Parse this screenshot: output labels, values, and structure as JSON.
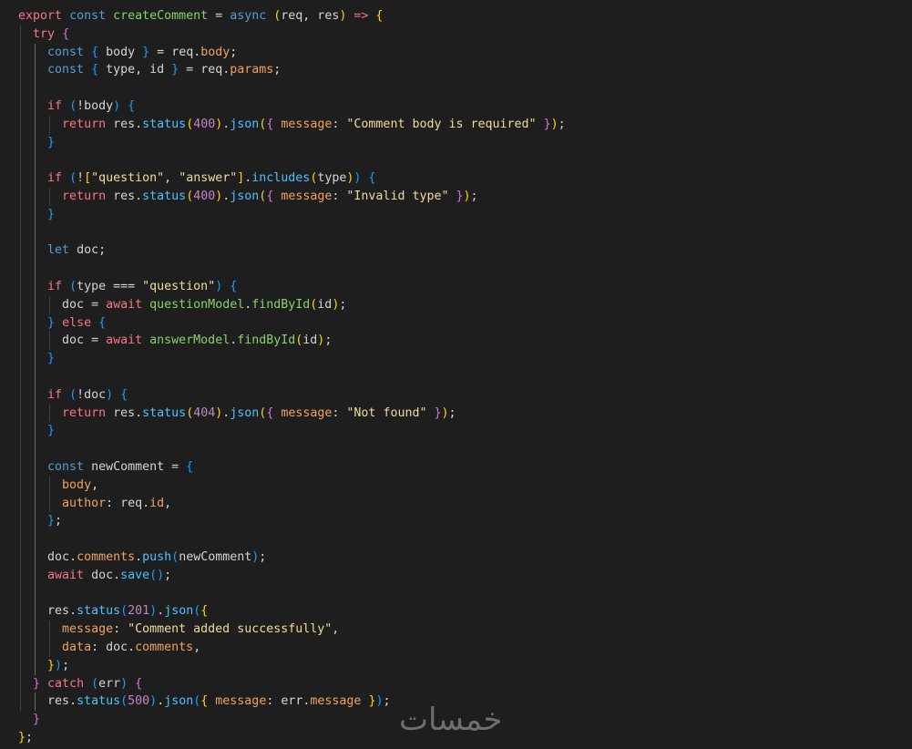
{
  "colors": {
    "kw": "#f97583",
    "decl": "#569cd6",
    "ctrl": "#f97583",
    "fn": "#4fc1ff",
    "fnname": "#86d36b",
    "str": "#f0dc9a",
    "num": "#c586c0",
    "prop": "#f0a35e",
    "plain": "#d4d4d4",
    "punct": "#d4d4d4",
    "b1": "#ffd700",
    "b2": "#da70d6",
    "b3": "#179fff",
    "op": "#d4d4d4"
  },
  "watermark": "خمسات",
  "lines": [
    [
      [
        "export",
        "kw"
      ],
      [
        " ",
        "plain"
      ],
      [
        "const",
        "decl"
      ],
      [
        " ",
        "plain"
      ],
      [
        "createComment",
        "fnname"
      ],
      [
        " = ",
        "op"
      ],
      [
        "async",
        "decl"
      ],
      [
        " ",
        "plain"
      ],
      [
        "(",
        "b1"
      ],
      [
        "req, res",
        "plain"
      ],
      [
        ")",
        "b1"
      ],
      [
        " => ",
        "kw"
      ],
      [
        "{",
        "b1"
      ]
    ],
    [
      [
        "  ",
        "plain"
      ],
      [
        "try",
        "kw"
      ],
      [
        " ",
        "plain"
      ],
      [
        "{",
        "b2"
      ]
    ],
    [
      [
        "    ",
        "plain"
      ],
      [
        "const",
        "decl"
      ],
      [
        " ",
        "plain"
      ],
      [
        "{",
        "b3"
      ],
      [
        " body ",
        "plain"
      ],
      [
        "}",
        "b3"
      ],
      [
        " = ",
        "op"
      ],
      [
        "req",
        "plain"
      ],
      [
        ".",
        "punct"
      ],
      [
        "body",
        "prop"
      ],
      [
        ";",
        "punct"
      ]
    ],
    [
      [
        "    ",
        "plain"
      ],
      [
        "const",
        "decl"
      ],
      [
        " ",
        "plain"
      ],
      [
        "{",
        "b3"
      ],
      [
        " type, id ",
        "plain"
      ],
      [
        "}",
        "b3"
      ],
      [
        " = ",
        "op"
      ],
      [
        "req",
        "plain"
      ],
      [
        ".",
        "punct"
      ],
      [
        "params",
        "prop"
      ],
      [
        ";",
        "punct"
      ]
    ],
    [],
    [
      [
        "    ",
        "plain"
      ],
      [
        "if",
        "kw"
      ],
      [
        " ",
        "plain"
      ],
      [
        "(",
        "b3"
      ],
      [
        "!body",
        "plain"
      ],
      [
        ")",
        "b3"
      ],
      [
        " ",
        "plain"
      ],
      [
        "{",
        "b3"
      ]
    ],
    [
      [
        "      ",
        "plain"
      ],
      [
        "return",
        "kw"
      ],
      [
        " res",
        "plain"
      ],
      [
        ".",
        "punct"
      ],
      [
        "status",
        "fn"
      ],
      [
        "(",
        "b1"
      ],
      [
        "400",
        "num"
      ],
      [
        ")",
        "b1"
      ],
      [
        ".",
        "punct"
      ],
      [
        "json",
        "fn"
      ],
      [
        "(",
        "b1"
      ],
      [
        "{",
        "b2"
      ],
      [
        " ",
        "plain"
      ],
      [
        "message",
        "prop"
      ],
      [
        ": ",
        "punct"
      ],
      [
        "\"Comment body is required\"",
        "str"
      ],
      [
        " ",
        "plain"
      ],
      [
        "}",
        "b2"
      ],
      [
        ")",
        "b1"
      ],
      [
        ";",
        "punct"
      ]
    ],
    [
      [
        "    ",
        "plain"
      ],
      [
        "}",
        "b3"
      ]
    ],
    [],
    [
      [
        "    ",
        "plain"
      ],
      [
        "if",
        "kw"
      ],
      [
        " ",
        "plain"
      ],
      [
        "(",
        "b3"
      ],
      [
        "!",
        "plain"
      ],
      [
        "[",
        "b1"
      ],
      [
        "\"question\"",
        "str"
      ],
      [
        ", ",
        "plain"
      ],
      [
        "\"answer\"",
        "str"
      ],
      [
        "]",
        "b1"
      ],
      [
        ".",
        "punct"
      ],
      [
        "includes",
        "fn"
      ],
      [
        "(",
        "b1"
      ],
      [
        "type",
        "plain"
      ],
      [
        ")",
        "b1"
      ],
      [
        ")",
        "b3"
      ],
      [
        " ",
        "plain"
      ],
      [
        "{",
        "b3"
      ]
    ],
    [
      [
        "      ",
        "plain"
      ],
      [
        "return",
        "kw"
      ],
      [
        " res",
        "plain"
      ],
      [
        ".",
        "punct"
      ],
      [
        "status",
        "fn"
      ],
      [
        "(",
        "b1"
      ],
      [
        "400",
        "num"
      ],
      [
        ")",
        "b1"
      ],
      [
        ".",
        "punct"
      ],
      [
        "json",
        "fn"
      ],
      [
        "(",
        "b1"
      ],
      [
        "{",
        "b2"
      ],
      [
        " ",
        "plain"
      ],
      [
        "message",
        "prop"
      ],
      [
        ": ",
        "punct"
      ],
      [
        "\"Invalid type\"",
        "str"
      ],
      [
        " ",
        "plain"
      ],
      [
        "}",
        "b2"
      ],
      [
        ")",
        "b1"
      ],
      [
        ";",
        "punct"
      ]
    ],
    [
      [
        "    ",
        "plain"
      ],
      [
        "}",
        "b3"
      ]
    ],
    [],
    [
      [
        "    ",
        "plain"
      ],
      [
        "let",
        "decl"
      ],
      [
        " doc;",
        "plain"
      ]
    ],
    [],
    [
      [
        "    ",
        "plain"
      ],
      [
        "if",
        "kw"
      ],
      [
        " ",
        "plain"
      ],
      [
        "(",
        "b3"
      ],
      [
        "type === ",
        "plain"
      ],
      [
        "\"question\"",
        "str"
      ],
      [
        ")",
        "b3"
      ],
      [
        " ",
        "plain"
      ],
      [
        "{",
        "b3"
      ]
    ],
    [
      [
        "      ",
        "plain"
      ],
      [
        "doc = ",
        "plain"
      ],
      [
        "await",
        "kw"
      ],
      [
        " ",
        "plain"
      ],
      [
        "questionModel",
        "fnname"
      ],
      [
        ".",
        "punct"
      ],
      [
        "findById",
        "fnname"
      ],
      [
        "(",
        "b1"
      ],
      [
        "id",
        "plain"
      ],
      [
        ")",
        "b1"
      ],
      [
        ";",
        "punct"
      ]
    ],
    [
      [
        "    ",
        "plain"
      ],
      [
        "}",
        "b3"
      ],
      [
        " ",
        "plain"
      ],
      [
        "else",
        "kw"
      ],
      [
        " ",
        "plain"
      ],
      [
        "{",
        "b3"
      ]
    ],
    [
      [
        "      ",
        "plain"
      ],
      [
        "doc = ",
        "plain"
      ],
      [
        "await",
        "kw"
      ],
      [
        " ",
        "plain"
      ],
      [
        "answerModel",
        "fnname"
      ],
      [
        ".",
        "punct"
      ],
      [
        "findById",
        "fnname"
      ],
      [
        "(",
        "b1"
      ],
      [
        "id",
        "plain"
      ],
      [
        ")",
        "b1"
      ],
      [
        ";",
        "punct"
      ]
    ],
    [
      [
        "    ",
        "plain"
      ],
      [
        "}",
        "b3"
      ]
    ],
    [],
    [
      [
        "    ",
        "plain"
      ],
      [
        "if",
        "kw"
      ],
      [
        " ",
        "plain"
      ],
      [
        "(",
        "b3"
      ],
      [
        "!doc",
        "plain"
      ],
      [
        ")",
        "b3"
      ],
      [
        " ",
        "plain"
      ],
      [
        "{",
        "b3"
      ]
    ],
    [
      [
        "      ",
        "plain"
      ],
      [
        "return",
        "kw"
      ],
      [
        " res",
        "plain"
      ],
      [
        ".",
        "punct"
      ],
      [
        "status",
        "fn"
      ],
      [
        "(",
        "b1"
      ],
      [
        "404",
        "num"
      ],
      [
        ")",
        "b1"
      ],
      [
        ".",
        "punct"
      ],
      [
        "json",
        "fn"
      ],
      [
        "(",
        "b1"
      ],
      [
        "{",
        "b2"
      ],
      [
        " ",
        "plain"
      ],
      [
        "message",
        "prop"
      ],
      [
        ": ",
        "punct"
      ],
      [
        "\"Not found\"",
        "str"
      ],
      [
        " ",
        "plain"
      ],
      [
        "}",
        "b2"
      ],
      [
        ")",
        "b1"
      ],
      [
        ";",
        "punct"
      ]
    ],
    [
      [
        "    ",
        "plain"
      ],
      [
        "}",
        "b3"
      ]
    ],
    [],
    [
      [
        "    ",
        "plain"
      ],
      [
        "const",
        "decl"
      ],
      [
        " newComment = ",
        "plain"
      ],
      [
        "{",
        "b3"
      ]
    ],
    [
      [
        "      ",
        "plain"
      ],
      [
        "body",
        "prop"
      ],
      [
        ",",
        "punct"
      ]
    ],
    [
      [
        "      ",
        "plain"
      ],
      [
        "author",
        "prop"
      ],
      [
        ": ",
        "punct"
      ],
      [
        "req",
        "plain"
      ],
      [
        ".",
        "punct"
      ],
      [
        "id",
        "prop"
      ],
      [
        ",",
        "punct"
      ]
    ],
    [
      [
        "    ",
        "plain"
      ],
      [
        "}",
        "b3"
      ],
      [
        ";",
        "punct"
      ]
    ],
    [],
    [
      [
        "    ",
        "plain"
      ],
      [
        "doc",
        "plain"
      ],
      [
        ".",
        "punct"
      ],
      [
        "comments",
        "prop"
      ],
      [
        ".",
        "punct"
      ],
      [
        "push",
        "fn"
      ],
      [
        "(",
        "b3"
      ],
      [
        "newComment",
        "plain"
      ],
      [
        ")",
        "b3"
      ],
      [
        ";",
        "punct"
      ]
    ],
    [
      [
        "    ",
        "plain"
      ],
      [
        "await",
        "kw"
      ],
      [
        " doc",
        "plain"
      ],
      [
        ".",
        "punct"
      ],
      [
        "save",
        "fn"
      ],
      [
        "(",
        "b3"
      ],
      [
        ")",
        "b3"
      ],
      [
        ";",
        "punct"
      ]
    ],
    [],
    [
      [
        "    ",
        "plain"
      ],
      [
        "res",
        "plain"
      ],
      [
        ".",
        "punct"
      ],
      [
        "status",
        "fn"
      ],
      [
        "(",
        "b3"
      ],
      [
        "201",
        "num"
      ],
      [
        ")",
        "b3"
      ],
      [
        ".",
        "punct"
      ],
      [
        "json",
        "fn"
      ],
      [
        "(",
        "b3"
      ],
      [
        "{",
        "b1"
      ]
    ],
    [
      [
        "      ",
        "plain"
      ],
      [
        "message",
        "prop"
      ],
      [
        ": ",
        "punct"
      ],
      [
        "\"Comment added successfully\"",
        "str"
      ],
      [
        ",",
        "punct"
      ]
    ],
    [
      [
        "      ",
        "plain"
      ],
      [
        "data",
        "prop"
      ],
      [
        ": ",
        "punct"
      ],
      [
        "doc",
        "plain"
      ],
      [
        ".",
        "punct"
      ],
      [
        "comments",
        "prop"
      ],
      [
        ",",
        "punct"
      ]
    ],
    [
      [
        "    ",
        "plain"
      ],
      [
        "}",
        "b1"
      ],
      [
        ")",
        "b3"
      ],
      [
        ";",
        "punct"
      ]
    ],
    [
      [
        "  ",
        "plain"
      ],
      [
        "}",
        "b2"
      ],
      [
        " ",
        "plain"
      ],
      [
        "catch",
        "kw"
      ],
      [
        " ",
        "plain"
      ],
      [
        "(",
        "b3"
      ],
      [
        "err",
        "plain"
      ],
      [
        ")",
        "b3"
      ],
      [
        " ",
        "plain"
      ],
      [
        "{",
        "b2"
      ]
    ],
    [
      [
        "    ",
        "plain"
      ],
      [
        "res",
        "plain"
      ],
      [
        ".",
        "punct"
      ],
      [
        "status",
        "fn"
      ],
      [
        "(",
        "b3"
      ],
      [
        "500",
        "num"
      ],
      [
        ")",
        "b3"
      ],
      [
        ".",
        "punct"
      ],
      [
        "json",
        "fn"
      ],
      [
        "(",
        "b3"
      ],
      [
        "{",
        "b1"
      ],
      [
        " ",
        "plain"
      ],
      [
        "message",
        "prop"
      ],
      [
        ": ",
        "punct"
      ],
      [
        "err",
        "plain"
      ],
      [
        ".",
        "punct"
      ],
      [
        "message",
        "prop"
      ],
      [
        " ",
        "plain"
      ],
      [
        "}",
        "b1"
      ],
      [
        ")",
        "b3"
      ],
      [
        ";",
        "punct"
      ]
    ],
    [
      [
        "  ",
        "plain"
      ],
      [
        "}",
        "b2"
      ]
    ],
    [
      [
        "}",
        "b1"
      ],
      [
        ";",
        "punct"
      ]
    ]
  ]
}
